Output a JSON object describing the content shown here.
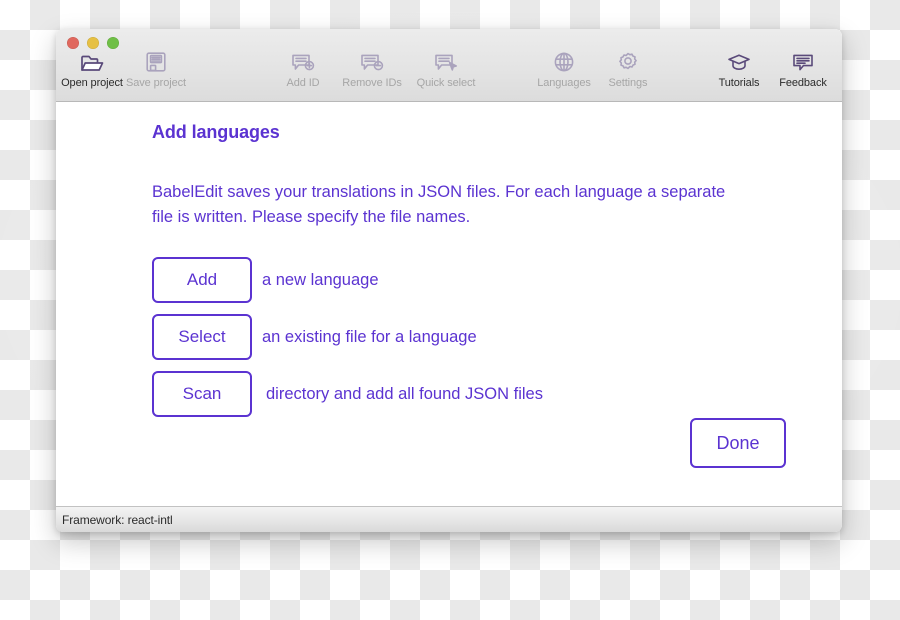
{
  "window": {
    "traffic_lights": [
      {
        "name": "close",
        "color": "#e0685e"
      },
      {
        "name": "minimize",
        "color": "#e6c043"
      },
      {
        "name": "zoom",
        "color": "#6fbf46"
      }
    ]
  },
  "toolbar": {
    "groups": [
      {
        "name": "project",
        "items": [
          {
            "label": "Open project",
            "icon": "folder-open-icon",
            "enabled": true
          },
          {
            "label": "Save project",
            "icon": "floppy-disk-icon",
            "enabled": false
          }
        ]
      },
      {
        "name": "ids",
        "items": [
          {
            "label": "Add ID",
            "icon": "speech-bubble-plus-icon",
            "enabled": false
          },
          {
            "label": "Remove IDs",
            "icon": "speech-bubble-minus-icon",
            "enabled": false
          },
          {
            "label": "Quick select",
            "icon": "speech-bubble-cursor-icon",
            "enabled": false
          }
        ]
      },
      {
        "name": "config",
        "items": [
          {
            "label": "Languages",
            "icon": "globe-icon",
            "enabled": false
          },
          {
            "label": "Settings",
            "icon": "gear-icon",
            "enabled": false
          }
        ]
      },
      {
        "name": "help",
        "items": [
          {
            "label": "Tutorials",
            "icon": "graduation-cap-icon",
            "enabled": true
          },
          {
            "label": "Feedback",
            "icon": "speech-bubble-lines-icon",
            "enabled": true
          }
        ]
      }
    ]
  },
  "panel": {
    "title": "Add languages",
    "description": "BabelEdit saves your translations in JSON files. For each language a separate file is written. Please specify the file names.",
    "choices": [
      {
        "button": "Add",
        "text": "a new language"
      },
      {
        "button": "Select",
        "text": "an existing file for a language"
      },
      {
        "button": "Scan",
        "text": "directory and add all found JSON files"
      }
    ],
    "done_label": "Done"
  },
  "statusbar": {
    "text": "Framework: react-intl"
  },
  "colors": {
    "accent_purple": "#5b33d1",
    "toolbar_bg": "#e6e6e6",
    "content_bg": "#ffffff",
    "status_text": "#2a2a2a"
  }
}
